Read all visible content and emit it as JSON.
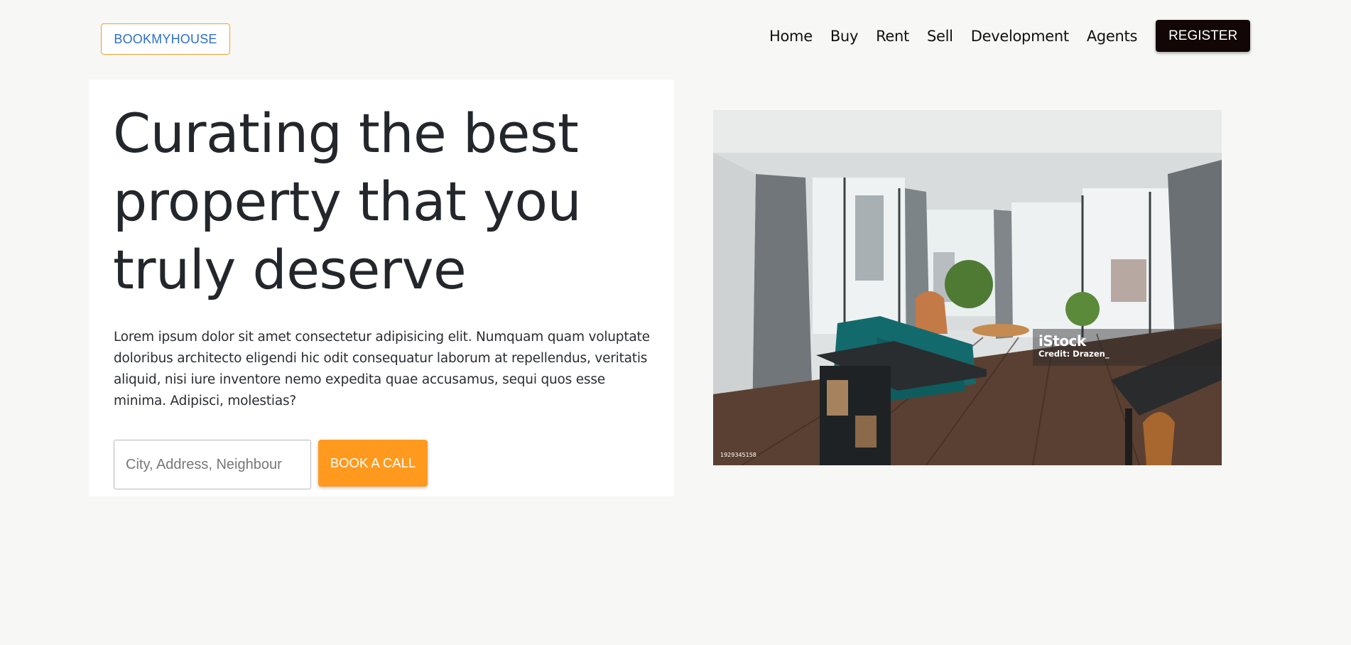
{
  "header": {
    "logo": "BOOKMYHOUSE",
    "nav": [
      "Home",
      "Buy",
      "Rent",
      "Sell",
      "Development",
      "Agents"
    ],
    "register_label": "REGISTER"
  },
  "hero": {
    "title": "Curating the best property that you truly deserve",
    "description": "Lorem ipsum dolor sit amet consectetur adipisicing elit. Numquam quam voluptate doloribus architecto eligendi hic odit consequatur laborum at repellendus, veritatis aliquid, nisi iure inventore nemo expedita quae accusamus, sequi quos esse minima. Adipisci, molestias?",
    "search_placeholder": "City, Address, Neighbour",
    "search_value": "",
    "book_label": "BOOK A CALL"
  },
  "image": {
    "watermark_brand": "iStock",
    "watermark_credit": "Credit: Drazen_",
    "image_id": "1929345158"
  },
  "colors": {
    "background": "#f7f7f5",
    "accent_orange": "#ff9a1e",
    "logo_blue": "#2d6fc9",
    "register_dark": "#120606"
  }
}
